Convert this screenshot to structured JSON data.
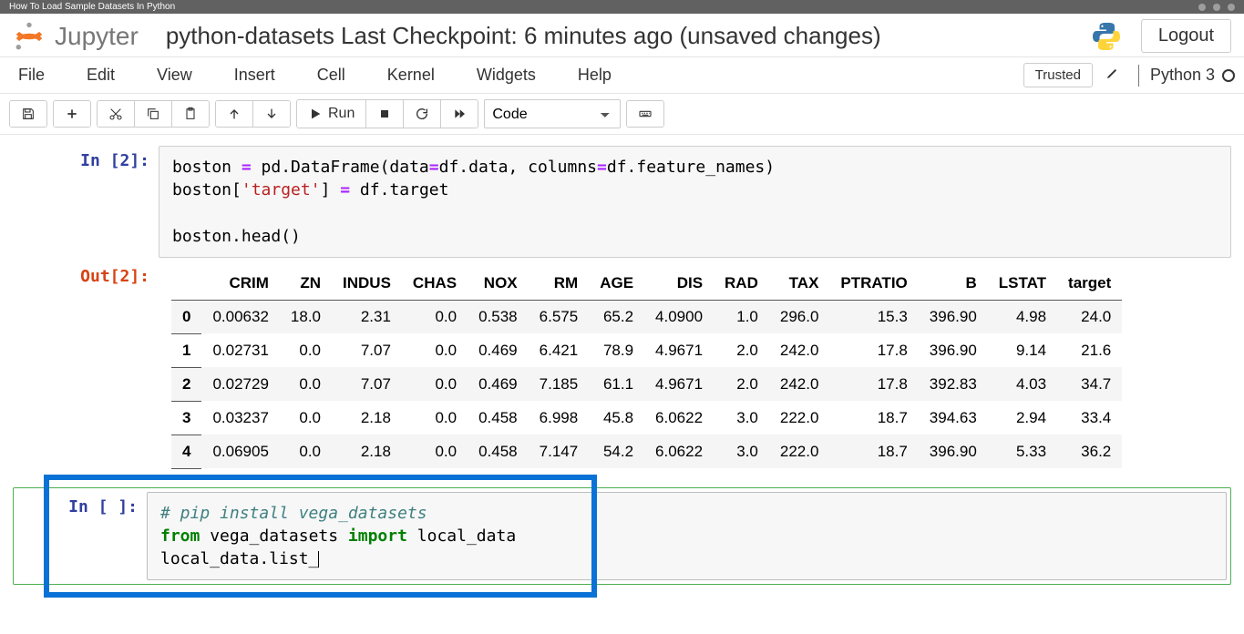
{
  "topbar": {
    "title": "How To Load Sample Datasets In Python"
  },
  "header": {
    "logo_word": "Jupyter",
    "notebook_title": "python-datasets Last Checkpoint: 6 minutes ago  (unsaved changes)",
    "logout": "Logout"
  },
  "menubar": {
    "items": [
      "File",
      "Edit",
      "View",
      "Insert",
      "Cell",
      "Kernel",
      "Widgets",
      "Help"
    ],
    "trusted": "Trusted",
    "kernel": "Python 3"
  },
  "toolbar": {
    "run_label": "Run",
    "cell_type": "Code"
  },
  "cells": {
    "in2_prompt": "In [2]:",
    "out2_prompt": "Out[2]:",
    "in_blank_prompt": "In [ ]:",
    "code2": {
      "l1a": "boston ",
      "l1op": "=",
      "l1b": " pd.DataFrame(data",
      "l1op2": "=",
      "l1c": "df.data, columns",
      "l1op3": "=",
      "l1d": "df.feature_names)",
      "l2a": "boston[",
      "l2str": "'target'",
      "l2b": "] ",
      "l2op": "=",
      "l2c": " df.target",
      "l3": "boston.head()"
    },
    "code_blank": {
      "com": "# pip install vega_datasets",
      "l2a": "from",
      "l2b": " vega_datasets ",
      "l2c": "import",
      "l2d": " local_data",
      "l3": "local_data.list_"
    }
  },
  "chart_data": {
    "type": "table",
    "columns": [
      "",
      "CRIM",
      "ZN",
      "INDUS",
      "CHAS",
      "NOX",
      "RM",
      "AGE",
      "DIS",
      "RAD",
      "TAX",
      "PTRATIO",
      "B",
      "LSTAT",
      "target"
    ],
    "rows": [
      [
        "0",
        "0.00632",
        "18.0",
        "2.31",
        "0.0",
        "0.538",
        "6.575",
        "65.2",
        "4.0900",
        "1.0",
        "296.0",
        "15.3",
        "396.90",
        "4.98",
        "24.0"
      ],
      [
        "1",
        "0.02731",
        "0.0",
        "7.07",
        "0.0",
        "0.469",
        "6.421",
        "78.9",
        "4.9671",
        "2.0",
        "242.0",
        "17.8",
        "396.90",
        "9.14",
        "21.6"
      ],
      [
        "2",
        "0.02729",
        "0.0",
        "7.07",
        "0.0",
        "0.469",
        "7.185",
        "61.1",
        "4.9671",
        "2.0",
        "242.0",
        "17.8",
        "392.83",
        "4.03",
        "34.7"
      ],
      [
        "3",
        "0.03237",
        "0.0",
        "2.18",
        "0.0",
        "0.458",
        "6.998",
        "45.8",
        "6.0622",
        "3.0",
        "222.0",
        "18.7",
        "394.63",
        "2.94",
        "33.4"
      ],
      [
        "4",
        "0.06905",
        "0.0",
        "2.18",
        "0.0",
        "0.458",
        "7.147",
        "54.2",
        "6.0622",
        "3.0",
        "222.0",
        "18.7",
        "396.90",
        "5.33",
        "36.2"
      ]
    ]
  }
}
